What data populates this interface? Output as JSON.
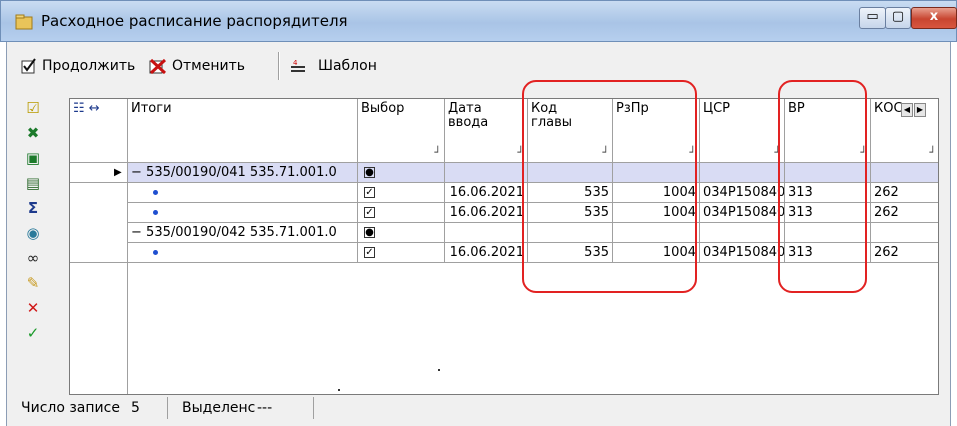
{
  "window": {
    "title": "Расходное расписание распорядителя",
    "min_label": "▭",
    "max_label": "▢",
    "close_label": "x"
  },
  "toolbar": {
    "continue_label": "Продолжить",
    "cancel_label": "Отменить",
    "template_label": "Шаблон"
  },
  "sidebar_icons": [
    "checklist-icon",
    "excel-icon",
    "excel-export-icon",
    "save-icon",
    "sum-icon",
    "globe-icon",
    "binoculars-icon",
    "eraser-icon",
    "delete-icon",
    "ok-icon"
  ],
  "grid": {
    "tree_header_mark": "↔",
    "columns": [
      {
        "key": "itogi",
        "label": "Итоги"
      },
      {
        "key": "vybor",
        "label": "Выбор"
      },
      {
        "key": "data",
        "label": "Дата ввода"
      },
      {
        "key": "kod",
        "label": "Код главы"
      },
      {
        "key": "rzpr",
        "label": "РзПр"
      },
      {
        "key": "csr",
        "label": "ЦСР"
      },
      {
        "key": "vr",
        "label": "ВР"
      },
      {
        "key": "kosgu",
        "label": "КОС"
      }
    ],
    "rows": [
      {
        "type": "group",
        "itogi": "535/00190/041 535.71.001.0",
        "vybor": "radio",
        "data": "",
        "kod": "",
        "rzpr": "",
        "csr": "",
        "vr": "",
        "kosgu": "",
        "current": true
      },
      {
        "type": "item",
        "itogi": "",
        "vybor": "checked",
        "data": "16.06.2021",
        "kod": "535",
        "rzpr": "1004",
        "csr": "034P150840",
        "vr": "313",
        "kosgu": "262"
      },
      {
        "type": "item",
        "itogi": "",
        "vybor": "checked",
        "data": "16.06.2021",
        "kod": "535",
        "rzpr": "1004",
        "csr": "034P150840",
        "vr": "313",
        "kosgu": "262"
      },
      {
        "type": "group",
        "itogi": "535/00190/042 535.71.001.0",
        "vybor": "radio",
        "data": "",
        "kod": "",
        "rzpr": "",
        "csr": "",
        "vr": "",
        "kosgu": "",
        "current": false
      },
      {
        "type": "item",
        "itogi": "",
        "vybor": "checked",
        "data": "16.06.2021",
        "kod": "535",
        "rzpr": "1004",
        "csr": "034P150840",
        "vr": "313",
        "kosgu": "262"
      }
    ]
  },
  "status": {
    "records_label": "Число записе",
    "records_count": "5",
    "selected_label": "Выделенс",
    "selected_value": "---"
  },
  "colors": {
    "group_row_bg": "#d9dcf4",
    "annotation": "#e22222"
  }
}
